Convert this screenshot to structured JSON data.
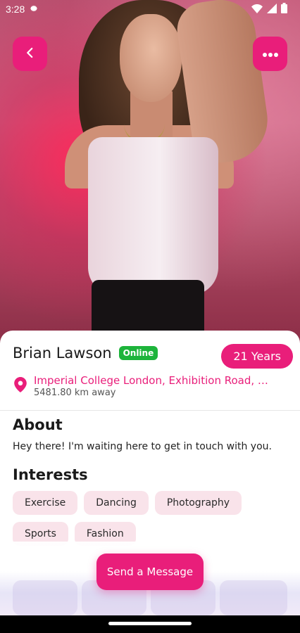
{
  "status_bar": {
    "time": "3:28",
    "icons": [
      "settings-icon",
      "wifi-icon",
      "signal-icon",
      "battery-icon"
    ]
  },
  "header": {
    "back_icon": "chevron-left-icon",
    "menu_icon": "more-horizontal-icon"
  },
  "profile": {
    "name": "Brian Lawson",
    "status_badge": "Online",
    "age_label": "21 Years",
    "location": "Imperial College London, Exhibition Road, …",
    "distance": "5481.80 km away",
    "about_title": "About",
    "about_text": "Hey there! I'm waiting here to get in touch with you.",
    "interests_title": "Interests",
    "interests": [
      "Exercise",
      "Dancing",
      "Photography",
      "Sports",
      "Fashion"
    ]
  },
  "actions": {
    "send_message": "Send a Message"
  },
  "colors": {
    "accent": "#e91e7a",
    "online": "#1db43b",
    "chip_bg": "#f9e3ea"
  }
}
